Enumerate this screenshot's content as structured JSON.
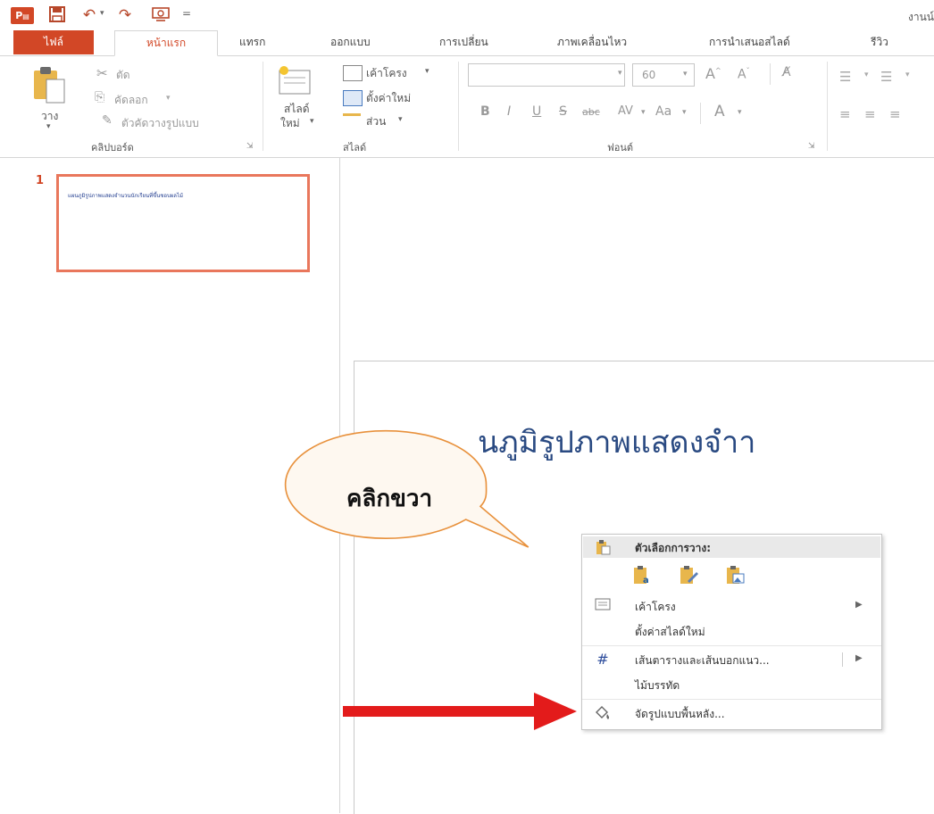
{
  "qat": {
    "app_badge": "P​",
    "redo_icon": "↷",
    "undo_icon": "↶",
    "doc_title": "งานน์"
  },
  "tabs": {
    "file": "ไฟล์",
    "home": "หน้าแรก",
    "insert": "แทรก",
    "design": "ออกแบบ",
    "transitions": "การเปลี่ยน",
    "animations": "ภาพเคลื่อนไหว",
    "slideshow": "การนำเสนอสไลด์",
    "review": "รีวิว"
  },
  "ribbon": {
    "clipboard": {
      "paste": "วาง",
      "cut": "ตัด",
      "copy": "คัดลอก",
      "format_painter": "ตัวคัดวางรูปแบบ",
      "group_label": "คลิปบอร์ด"
    },
    "slides": {
      "new_slide_line1": "สไลด์",
      "new_slide_line2": "ใหม่",
      "layout": "เค้าโครง",
      "reset": "ตั้งค่าใหม่",
      "section": "ส่วน",
      "group_label": "สไลด์"
    },
    "font": {
      "size": "60",
      "bold": "B",
      "italic": "I",
      "underline": "U",
      "strike": "S",
      "shadow": "abc",
      "spacing": "AV",
      "case": "Aa",
      "color": "A",
      "group_label": "ฟอนต์"
    }
  },
  "thumbnails": {
    "slide_number": "1",
    "slide_text": "แผนภูมิรูปภาพแสดงจำนวนนักเรียนที่ขึ้นชอบผลไม้"
  },
  "slide": {
    "title": "นภูมิรูปภาพแสดงจำา"
  },
  "callout": {
    "text": "คลิกขวา"
  },
  "context_menu": {
    "paste_options": "ตัวเลือกการวาง:",
    "layout": "เค้าโครง",
    "reset_slide": "ตั้งค่าสไลด์ใหม่",
    "grid_guides": "เส้นตารางและเส้นบอกแนว...",
    "ruler": "ไม้บรรทัด",
    "format_background": "จัดรูปแบบพื้นหลัง..."
  },
  "colors": {
    "accent": "#d24726",
    "thumb_border": "#e9775c",
    "title_blue": "#2a4a82",
    "callout_border": "#e8913c",
    "arrow_red": "#e31b1b"
  }
}
